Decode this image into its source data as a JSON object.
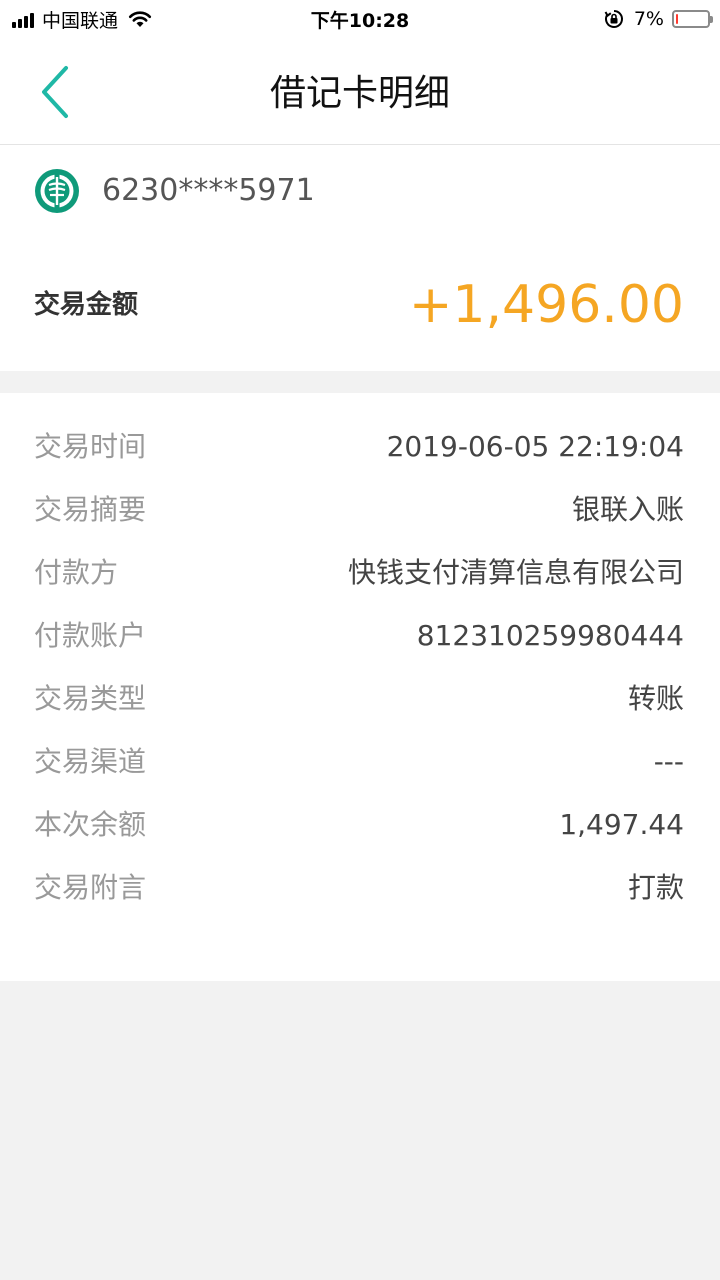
{
  "status_bar": {
    "carrier": "中国联通",
    "time": "下午10:28",
    "battery_percent": "7%",
    "battery_level": 0.07,
    "icons": [
      "signal-icon",
      "wifi-icon",
      "orientation-lock-icon",
      "battery-icon"
    ]
  },
  "nav": {
    "title": "借记卡明细",
    "back_icon": "chevron-left-icon",
    "accent_color": "#1fb8a6"
  },
  "card": {
    "bank_logo": "agricultural-bank-logo",
    "number": "6230****5971",
    "amount_label": "交易金额",
    "amount_value": "+1,496.00",
    "amount_color": "#f5a623"
  },
  "details": [
    {
      "label": "交易时间",
      "value": "2019-06-05 22:19:04"
    },
    {
      "label": "交易摘要",
      "value": "银联入账"
    },
    {
      "label": "付款方",
      "value": "快钱支付清算信息有限公司"
    },
    {
      "label": "付款账户",
      "value": "812310259980444"
    },
    {
      "label": "交易类型",
      "value": "转账"
    },
    {
      "label": "交易渠道",
      "value": "---"
    },
    {
      "label": "本次余额",
      "value": "1,497.44"
    },
    {
      "label": "交易附言",
      "value": "打款"
    }
  ]
}
